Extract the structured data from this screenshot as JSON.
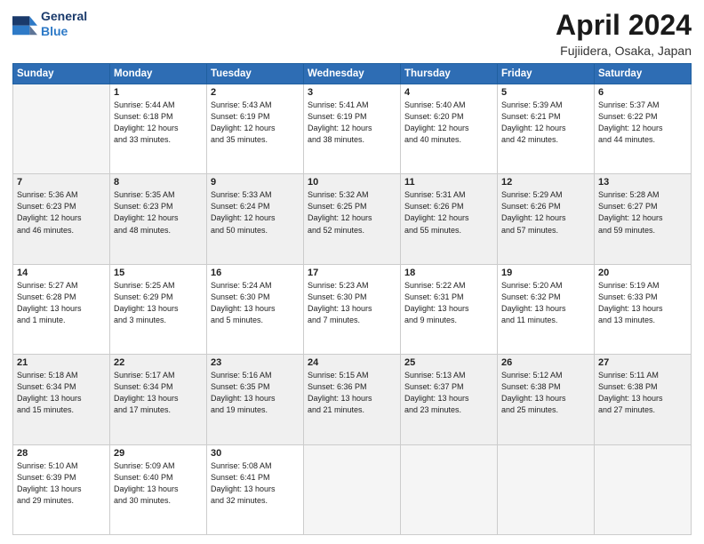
{
  "header": {
    "logo_line1": "General",
    "logo_line2": "Blue",
    "month": "April 2024",
    "location": "Fujiidera, Osaka, Japan"
  },
  "weekdays": [
    "Sunday",
    "Monday",
    "Tuesday",
    "Wednesday",
    "Thursday",
    "Friday",
    "Saturday"
  ],
  "weeks": [
    [
      {
        "day": "",
        "info": ""
      },
      {
        "day": "1",
        "info": "Sunrise: 5:44 AM\nSunset: 6:18 PM\nDaylight: 12 hours\nand 33 minutes."
      },
      {
        "day": "2",
        "info": "Sunrise: 5:43 AM\nSunset: 6:19 PM\nDaylight: 12 hours\nand 35 minutes."
      },
      {
        "day": "3",
        "info": "Sunrise: 5:41 AM\nSunset: 6:19 PM\nDaylight: 12 hours\nand 38 minutes."
      },
      {
        "day": "4",
        "info": "Sunrise: 5:40 AM\nSunset: 6:20 PM\nDaylight: 12 hours\nand 40 minutes."
      },
      {
        "day": "5",
        "info": "Sunrise: 5:39 AM\nSunset: 6:21 PM\nDaylight: 12 hours\nand 42 minutes."
      },
      {
        "day": "6",
        "info": "Sunrise: 5:37 AM\nSunset: 6:22 PM\nDaylight: 12 hours\nand 44 minutes."
      }
    ],
    [
      {
        "day": "7",
        "info": "Sunrise: 5:36 AM\nSunset: 6:23 PM\nDaylight: 12 hours\nand 46 minutes."
      },
      {
        "day": "8",
        "info": "Sunrise: 5:35 AM\nSunset: 6:23 PM\nDaylight: 12 hours\nand 48 minutes."
      },
      {
        "day": "9",
        "info": "Sunrise: 5:33 AM\nSunset: 6:24 PM\nDaylight: 12 hours\nand 50 minutes."
      },
      {
        "day": "10",
        "info": "Sunrise: 5:32 AM\nSunset: 6:25 PM\nDaylight: 12 hours\nand 52 minutes."
      },
      {
        "day": "11",
        "info": "Sunrise: 5:31 AM\nSunset: 6:26 PM\nDaylight: 12 hours\nand 55 minutes."
      },
      {
        "day": "12",
        "info": "Sunrise: 5:29 AM\nSunset: 6:26 PM\nDaylight: 12 hours\nand 57 minutes."
      },
      {
        "day": "13",
        "info": "Sunrise: 5:28 AM\nSunset: 6:27 PM\nDaylight: 12 hours\nand 59 minutes."
      }
    ],
    [
      {
        "day": "14",
        "info": "Sunrise: 5:27 AM\nSunset: 6:28 PM\nDaylight: 13 hours\nand 1 minute."
      },
      {
        "day": "15",
        "info": "Sunrise: 5:25 AM\nSunset: 6:29 PM\nDaylight: 13 hours\nand 3 minutes."
      },
      {
        "day": "16",
        "info": "Sunrise: 5:24 AM\nSunset: 6:30 PM\nDaylight: 13 hours\nand 5 minutes."
      },
      {
        "day": "17",
        "info": "Sunrise: 5:23 AM\nSunset: 6:30 PM\nDaylight: 13 hours\nand 7 minutes."
      },
      {
        "day": "18",
        "info": "Sunrise: 5:22 AM\nSunset: 6:31 PM\nDaylight: 13 hours\nand 9 minutes."
      },
      {
        "day": "19",
        "info": "Sunrise: 5:20 AM\nSunset: 6:32 PM\nDaylight: 13 hours\nand 11 minutes."
      },
      {
        "day": "20",
        "info": "Sunrise: 5:19 AM\nSunset: 6:33 PM\nDaylight: 13 hours\nand 13 minutes."
      }
    ],
    [
      {
        "day": "21",
        "info": "Sunrise: 5:18 AM\nSunset: 6:34 PM\nDaylight: 13 hours\nand 15 minutes."
      },
      {
        "day": "22",
        "info": "Sunrise: 5:17 AM\nSunset: 6:34 PM\nDaylight: 13 hours\nand 17 minutes."
      },
      {
        "day": "23",
        "info": "Sunrise: 5:16 AM\nSunset: 6:35 PM\nDaylight: 13 hours\nand 19 minutes."
      },
      {
        "day": "24",
        "info": "Sunrise: 5:15 AM\nSunset: 6:36 PM\nDaylight: 13 hours\nand 21 minutes."
      },
      {
        "day": "25",
        "info": "Sunrise: 5:13 AM\nSunset: 6:37 PM\nDaylight: 13 hours\nand 23 minutes."
      },
      {
        "day": "26",
        "info": "Sunrise: 5:12 AM\nSunset: 6:38 PM\nDaylight: 13 hours\nand 25 minutes."
      },
      {
        "day": "27",
        "info": "Sunrise: 5:11 AM\nSunset: 6:38 PM\nDaylight: 13 hours\nand 27 minutes."
      }
    ],
    [
      {
        "day": "28",
        "info": "Sunrise: 5:10 AM\nSunset: 6:39 PM\nDaylight: 13 hours\nand 29 minutes."
      },
      {
        "day": "29",
        "info": "Sunrise: 5:09 AM\nSunset: 6:40 PM\nDaylight: 13 hours\nand 30 minutes."
      },
      {
        "day": "30",
        "info": "Sunrise: 5:08 AM\nSunset: 6:41 PM\nDaylight: 13 hours\nand 32 minutes."
      },
      {
        "day": "",
        "info": ""
      },
      {
        "day": "",
        "info": ""
      },
      {
        "day": "",
        "info": ""
      },
      {
        "day": "",
        "info": ""
      }
    ]
  ]
}
